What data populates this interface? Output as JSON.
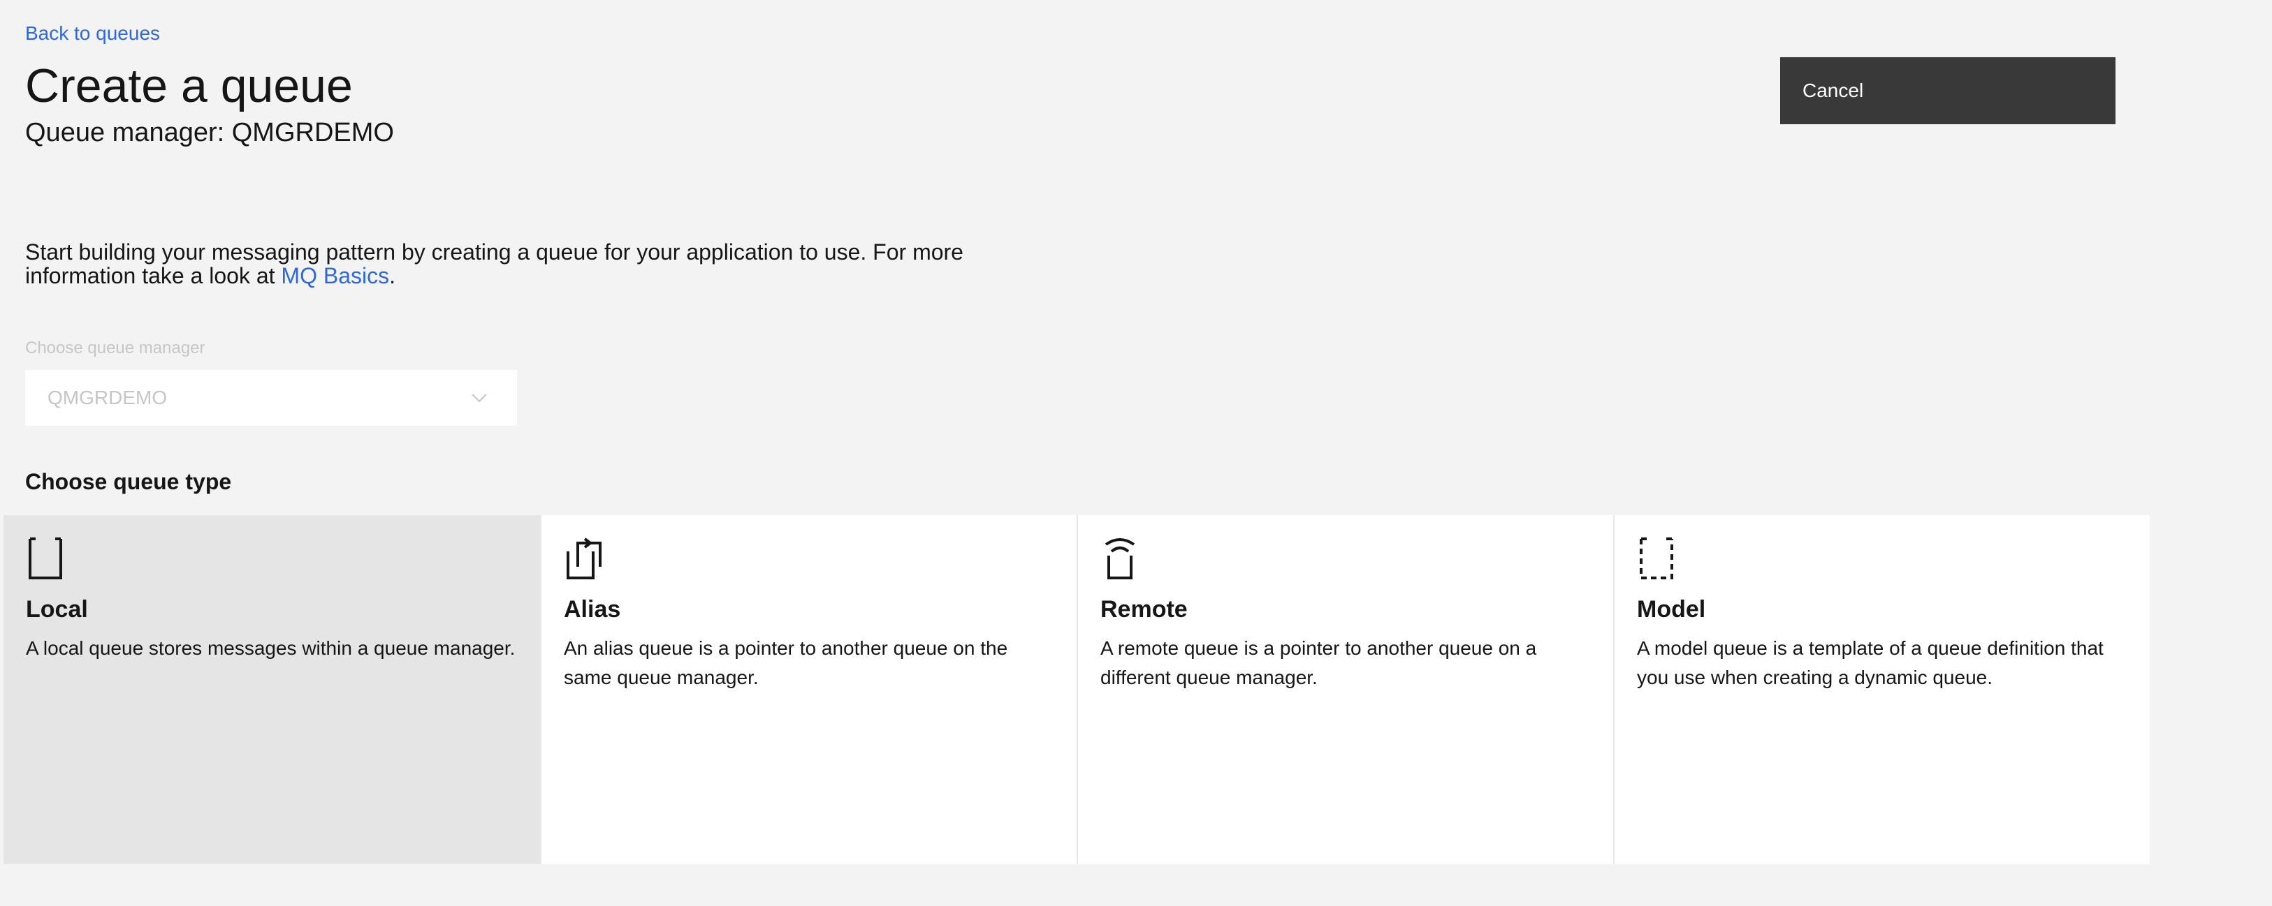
{
  "header": {
    "back_link": "Back to queues",
    "title": "Create a queue",
    "subtitle": "Queue manager: QMGRDEMO",
    "cancel_label": "Cancel"
  },
  "intro": {
    "text_before": "Start building your messaging pattern by creating a queue for your application to use. For more information take a look at ",
    "link_text": "MQ Basics",
    "text_after": "."
  },
  "queue_manager": {
    "label": "Choose queue manager",
    "selected_value": "QMGRDEMO",
    "disabled": true
  },
  "queue_types": {
    "heading": "Choose queue type",
    "selected": "Local",
    "items": [
      {
        "icon": "local-queue-icon",
        "title": "Local",
        "description": "A local queue stores messages within a queue manager."
      },
      {
        "icon": "alias-queue-icon",
        "title": "Alias",
        "description": "An alias queue is a pointer to another queue on the same queue manager."
      },
      {
        "icon": "remote-queue-icon",
        "title": "Remote",
        "description": "A remote queue is a pointer to another queue on a different queue manager."
      },
      {
        "icon": "model-queue-icon",
        "title": "Model",
        "description": "A model queue is a template of a queue definition that you use when creating a dynamic queue."
      }
    ]
  },
  "colors": {
    "link": "#2f68d8",
    "page_background": "#f3f3f3",
    "selected_tile": "#e5e5e5",
    "button_background": "#393939"
  }
}
